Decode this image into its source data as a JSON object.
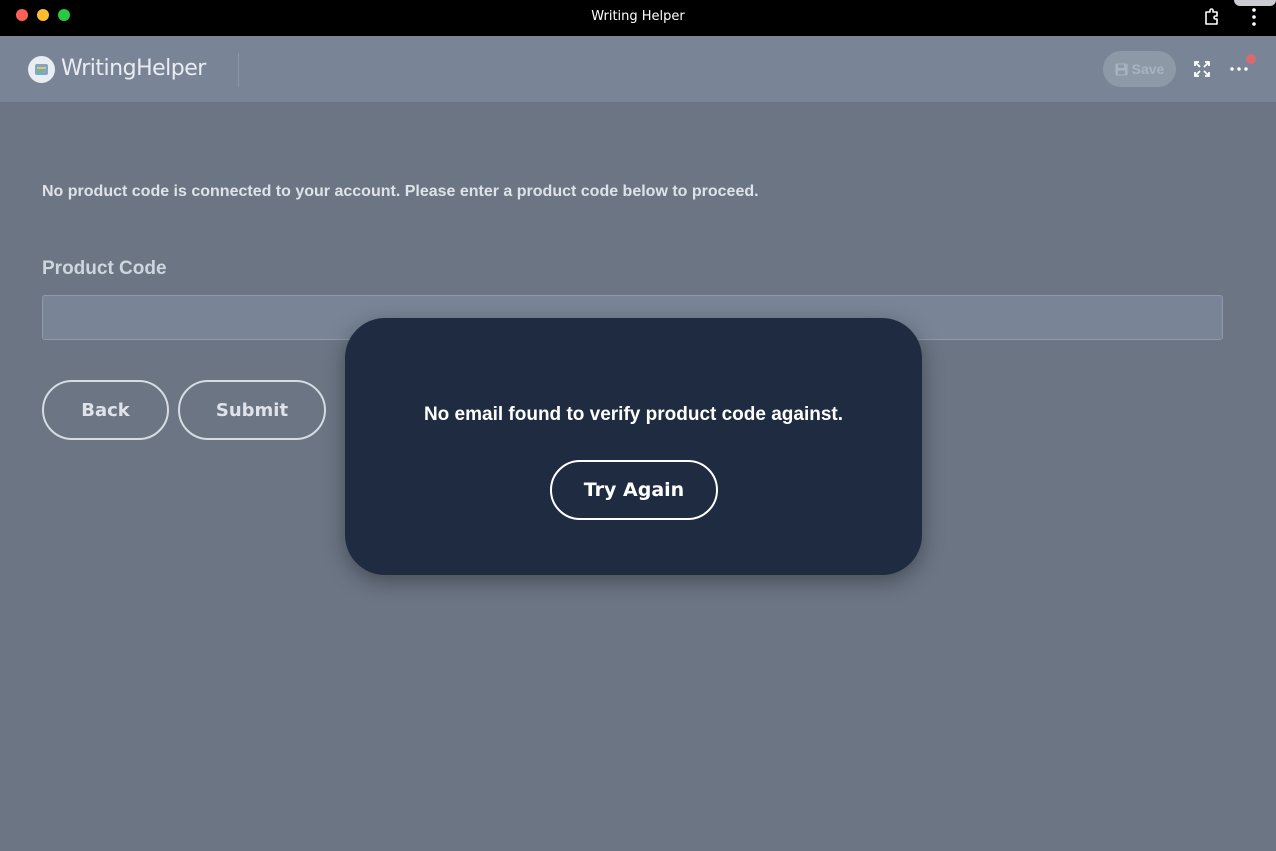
{
  "window": {
    "title": "Writing Helper"
  },
  "header": {
    "logo_text": "WritingHelper",
    "save_label": "Save"
  },
  "content": {
    "notice": "No product code is connected to your account. Please enter a product code below to proceed.",
    "field_label": "Product Code",
    "input_value": "",
    "input_placeholder": "",
    "back_label": "Back",
    "submit_label": "Submit"
  },
  "modal": {
    "message": "No email found to verify product code against.",
    "button_label": "Try Again"
  },
  "icons": {
    "logo": "writing-helper-logo-icon",
    "save": "floppy-disk-icon",
    "expand": "expand-icon",
    "more": "ellipsis-icon",
    "extension": "puzzle-extension-icon",
    "kebab": "kebab-menu-icon"
  },
  "colors": {
    "overlay_bg": "#6b7584",
    "header_bg": "#798597",
    "modal_bg": "#1e2b40",
    "notification_dot": "#d96a6e"
  }
}
